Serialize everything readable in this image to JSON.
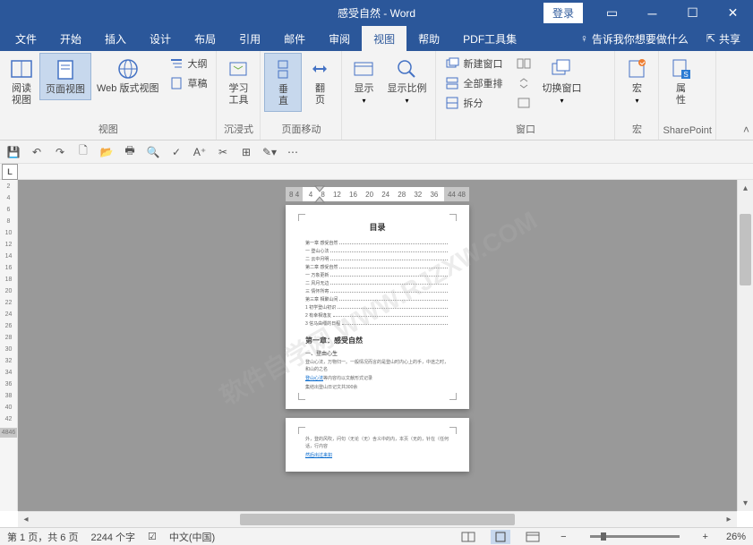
{
  "titlebar": {
    "title": "感受自然 - Word",
    "login": "登录"
  },
  "menu": {
    "tabs": [
      "文件",
      "开始",
      "插入",
      "设计",
      "布局",
      "引用",
      "邮件",
      "审阅",
      "视图",
      "帮助",
      "PDF工具集"
    ],
    "active": 8,
    "tell": "告诉我你想要做什么",
    "share": "共享"
  },
  "ribbon": {
    "views": {
      "label": "视图",
      "read": "阅读\n视图",
      "page": "页面视图",
      "web": "Web 版式视图",
      "outline": "大纲",
      "draft": "草稿"
    },
    "immersive": {
      "label": "沉浸式",
      "learn": "学习\n工具"
    },
    "pagemove": {
      "label": "页面移动",
      "vertical": "垂\n直",
      "flip": "翻\n页"
    },
    "show": {
      "label": "",
      "show": "显示",
      "ratio": "显示比例"
    },
    "window": {
      "label": "窗口",
      "new": "新建窗口",
      "arrange": "全部重排",
      "split": "拆分",
      "sidebyside": "",
      "switch": "切换窗口"
    },
    "macros": {
      "label": "宏",
      "macro": "宏"
    },
    "sharepoint": {
      "label": "SharePoint",
      "props": "属\n性"
    }
  },
  "hruler": {
    "darkL": [
      "8",
      "4"
    ],
    "light": [
      "4",
      "8",
      "12",
      "16",
      "20",
      "24",
      "28",
      "32",
      "36"
    ],
    "darkR": [
      "44",
      "48"
    ]
  },
  "vruler": [
    "2",
    "4",
    "6",
    "8",
    "10",
    "12",
    "14",
    "16",
    "18",
    "20",
    "22",
    "24",
    "26",
    "28",
    "30",
    "32",
    "34",
    "36",
    "38",
    "40",
    "42",
    "4846"
  ],
  "doc": {
    "toc_title": "目录",
    "toc": [
      "第一章 感受自然",
      "一 登山心法",
      "二 云中月明",
      "第二章 感受自然",
      "一 万象更新",
      "二 风月无边",
      "三 情怀所寄",
      "第三章 相聚山间",
      "1 初学登山初识",
      "2 有幸相逢友",
      "3 信马由缰的日程"
    ],
    "chapter": "第一章：感受自然",
    "section": "一、登由心生",
    "para1": "登山心法，万物归一。一般情况而言的是登山时内心上的手，中途之时，和山的之名",
    "link": "登山心法",
    "para1b": "等内容均以文献形式记录",
    "para2": "集结出登山日记文共300余",
    "page2": "外，登的风吹，问句（无论（无）含义中的内，本页（无的，针在（任何话，行内容",
    "page2b": "然后出过来如"
  },
  "watermark": "软件自学网 WWW.RJZXW.COM",
  "status": {
    "page": "第 1 页，共 6 页",
    "words": "2244 个字",
    "lang": "中文(中国)",
    "zoom": "26%"
  }
}
